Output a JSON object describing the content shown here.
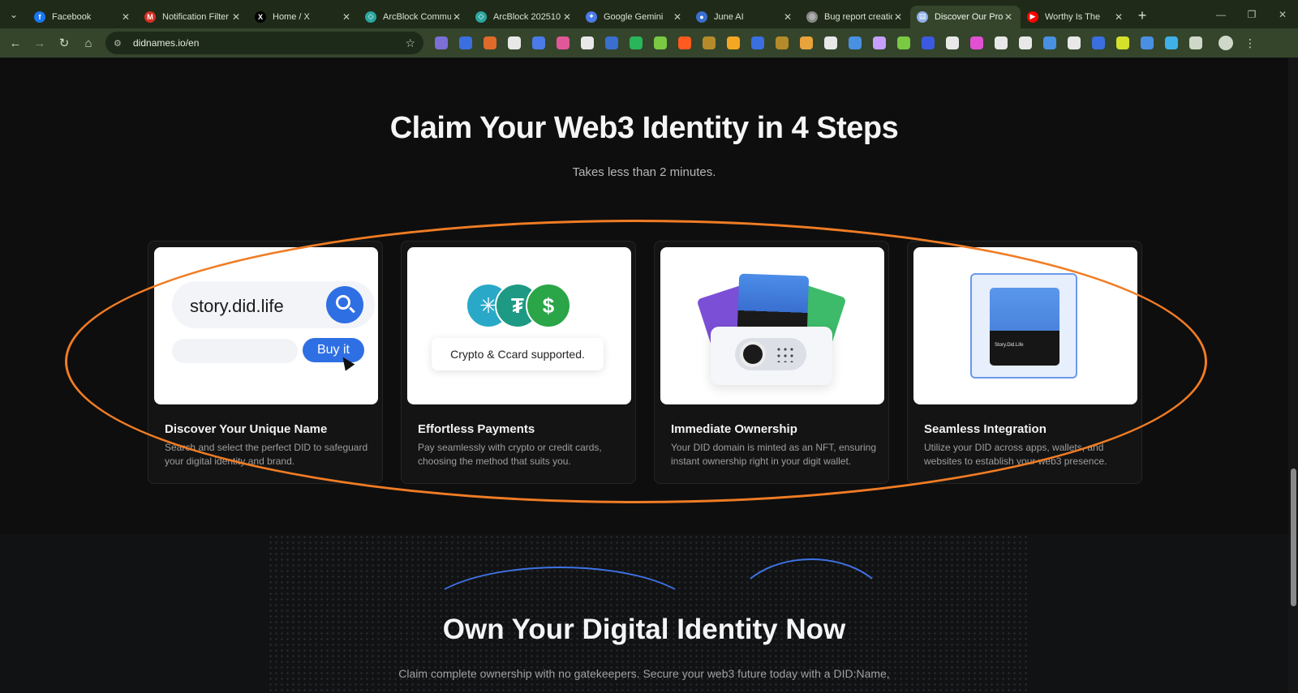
{
  "browser": {
    "tabs": [
      {
        "label": "Facebook",
        "icon": "facebook-icon",
        "color": "#1877f2",
        "glyph": "f",
        "active": false
      },
      {
        "label": "Notification Filter",
        "icon": "gmail-icon",
        "color": "#d93025",
        "glyph": "M",
        "active": false
      },
      {
        "label": "Home / X",
        "icon": "x-icon",
        "color": "#000000",
        "glyph": "X",
        "active": false
      },
      {
        "label": "ArcBlock Commu",
        "icon": "arcblock-icon",
        "color": "#2aa6a0",
        "glyph": "◇",
        "active": false
      },
      {
        "label": "ArcBlock 202510",
        "icon": "arcblock-icon",
        "color": "#2aa6a0",
        "glyph": "◇",
        "active": false
      },
      {
        "label": "Google Gemini",
        "icon": "gemini-icon",
        "color": "#4a7be8",
        "glyph": "✦",
        "active": false
      },
      {
        "label": "June AI",
        "icon": "june-ai-icon",
        "color": "#3a6ecf",
        "glyph": "●",
        "active": false
      },
      {
        "label": "Bug report creatio",
        "icon": "bug-report-icon",
        "color": "#8a8a8a",
        "glyph": "◎",
        "active": false
      },
      {
        "label": "Discover Our Prod",
        "icon": "page-icon",
        "color": "#8fb0e8",
        "glyph": "▤",
        "active": true
      },
      {
        "label": "Worthy Is The",
        "icon": "youtube-icon",
        "color": "#ff0000",
        "glyph": "▶",
        "active": false
      }
    ],
    "url": "didnames.io/en",
    "extension_colors": [
      "#7c6fd6",
      "#3b6fe0",
      "#e06a2a",
      "#e8e8e8",
      "#4a7be8",
      "#e0589a",
      "#e8e8e8",
      "#3a6ecf",
      "#2ab55a",
      "#7ac943",
      "#ff5a1f",
      "#b58a2a",
      "#f5a623",
      "#3b6fe0",
      "#b58a2a",
      "#e8a33a",
      "#e8e8e8",
      "#4a90e2",
      "#c7a0ff",
      "#7ac943",
      "#3b5ae0",
      "#e8e8e8",
      "#e050d0",
      "#e8e8e8",
      "#e8e8e8",
      "#4a90e2",
      "#e8e8e8",
      "#3b6fe0",
      "#d4e02a",
      "#4a90e2",
      "#3fb0e8",
      "#cfd8c8"
    ]
  },
  "page": {
    "heading": "Claim Your Web3 Identity in 4 Steps",
    "subheading": "Takes less than 2 minutes.",
    "accent_color": "#f07c24",
    "cards": [
      {
        "title": "Discover Your Unique Name",
        "desc": "Search and select the perfect DID to safeguard your digital identity and brand.",
        "search_text": "story.did.life",
        "button_label": "Buy it"
      },
      {
        "title": "Effortless Payments",
        "desc": "Pay seamlessly with crypto or credit cards, choosing the method that suits you.",
        "payment_label": "Crypto & Ccard supported."
      },
      {
        "title": "Immediate Ownership",
        "desc": "Your DID domain is minted as an NFT, ensuring instant ownership right in your digit wallet."
      },
      {
        "title": "Seamless Integration",
        "desc": "Utilize your DID across apps, wallets, and websites to establish your web3 presence.",
        "nft_caption": "Story.Did.Life"
      }
    ],
    "bottom_heading": "Own Your Digital Identity Now",
    "bottom_sub": "Claim complete ownership with no gatekeepers. Secure your web3 future today with a DID:Name,"
  }
}
